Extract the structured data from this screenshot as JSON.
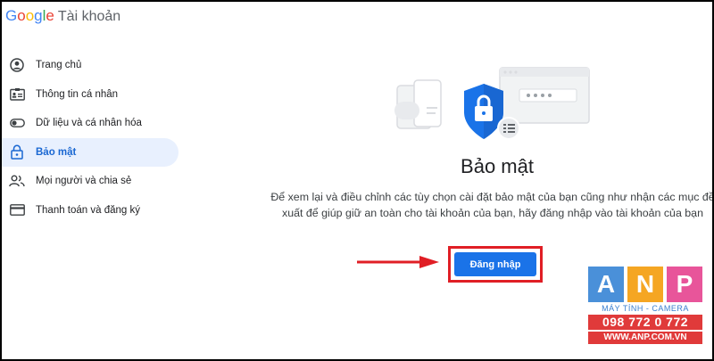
{
  "header": {
    "logo_text": "Google",
    "product": "Tài khoản"
  },
  "sidebar": {
    "items": [
      {
        "label": "Trang chủ",
        "icon": "account-circle-icon",
        "active": false
      },
      {
        "label": "Thông tin cá nhân",
        "icon": "id-card-icon",
        "active": false
      },
      {
        "label": "Dữ liệu và cá nhân hóa",
        "icon": "toggle-icon",
        "active": false
      },
      {
        "label": "Bảo mật",
        "icon": "lock-icon",
        "active": true
      },
      {
        "label": "Mọi người và chia sẻ",
        "icon": "people-icon",
        "active": false
      },
      {
        "label": "Thanh toán và đăng ký",
        "icon": "credit-card-icon",
        "active": false
      }
    ]
  },
  "main": {
    "title": "Bảo mật",
    "description": "Để xem lại và điều chỉnh các tùy chọn cài đặt bảo mật của bạn cũng như nhận các mục đề xuất để giúp giữ an toàn cho tài khoản của bạn, hãy đăng nhập vào tài khoản của bạn",
    "signin_label": "Đăng nhập"
  },
  "watermark": {
    "letters": [
      "A",
      "N",
      "P"
    ],
    "letter_colors": [
      "#4a90d9",
      "#f5a623",
      "#e8559a"
    ],
    "caption": "MÁY TÍNH - CAMERA",
    "phone": "098 772 0 772",
    "website": "WWW.ANP.COM.VN"
  },
  "colors": {
    "accent": "#1a73e8",
    "active_bg": "#e8f0fe",
    "highlight": "#e01e25"
  }
}
